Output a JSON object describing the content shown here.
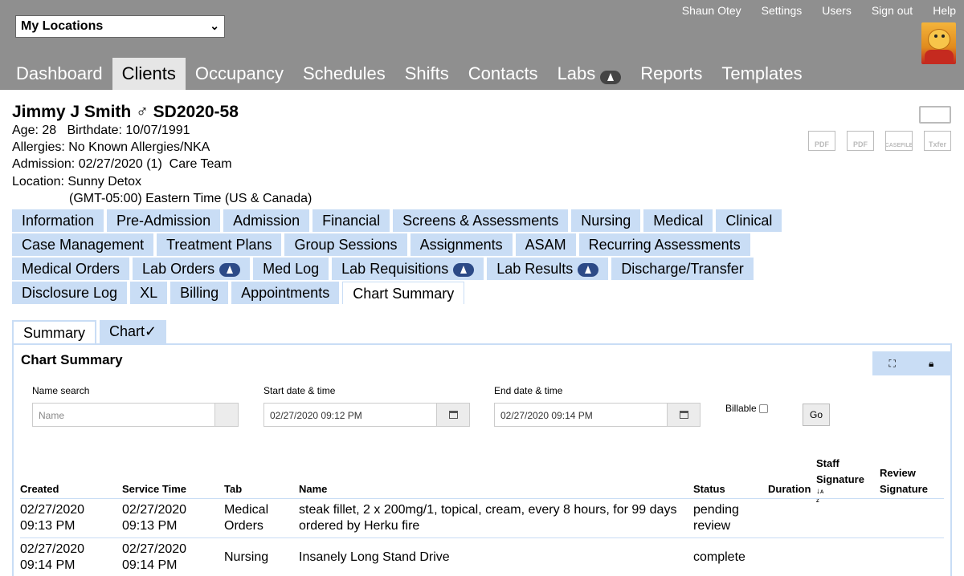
{
  "location_select": {
    "value": "My Locations"
  },
  "user_menu": [
    "Shaun Otey",
    "Settings",
    "Users",
    "Sign out",
    "Help"
  ],
  "nav": [
    {
      "label": "Dashboard",
      "active": false,
      "icon": null
    },
    {
      "label": "Clients",
      "active": true,
      "icon": null
    },
    {
      "label": "Occupancy",
      "active": false,
      "icon": null
    },
    {
      "label": "Schedules",
      "active": false,
      "icon": null
    },
    {
      "label": "Shifts",
      "active": false,
      "icon": null
    },
    {
      "label": "Contacts",
      "active": false,
      "icon": null
    },
    {
      "label": "Labs",
      "active": false,
      "icon": "flask-icon"
    },
    {
      "label": "Reports",
      "active": false,
      "icon": null
    },
    {
      "label": "Templates",
      "active": false,
      "icon": null
    }
  ],
  "patient": {
    "name": "Jimmy J Smith",
    "gender_symbol": "♂",
    "id": "SD2020-58",
    "age": "Age: 28",
    "birthdate": "Birthdate: 10/07/1991",
    "allergies": "Allergies: No Known Allergies/NKA",
    "admission": "Admission: 02/27/2020 (1)",
    "care_team": "Care Team",
    "location": "Location: Sunny Detox",
    "timezone": "(GMT-05:00) Eastern Time (US & Canada)"
  },
  "doc_icons": [
    "PDF",
    "PDF",
    "CASEFILE",
    "Txfer"
  ],
  "tab_rows": [
    [
      {
        "label": "Information"
      },
      {
        "label": "Pre-Admission"
      },
      {
        "label": "Admission"
      },
      {
        "label": "Financial"
      },
      {
        "label": "Screens & Assessments"
      },
      {
        "label": "Nursing"
      },
      {
        "label": "Medical"
      },
      {
        "label": "Clinical"
      }
    ],
    [
      {
        "label": "Case Management"
      },
      {
        "label": "Treatment Plans"
      },
      {
        "label": "Group Sessions"
      },
      {
        "label": "Assignments"
      },
      {
        "label": "ASAM"
      },
      {
        "label": "Recurring Assessments"
      }
    ],
    [
      {
        "label": "Medical Orders"
      },
      {
        "label": "Lab Orders",
        "icon": "flask-icon"
      },
      {
        "label": "Med Log"
      },
      {
        "label": "Lab Requisitions",
        "icon": "flask-icon"
      },
      {
        "label": "Lab Results",
        "icon": "flask-icon"
      },
      {
        "label": "Discharge/Transfer"
      }
    ],
    [
      {
        "label": "Disclosure Log"
      },
      {
        "label": "XL"
      },
      {
        "label": "Billing"
      },
      {
        "label": "Appointments"
      },
      {
        "label": "Chart Summary",
        "active": true
      }
    ]
  ],
  "subtabs": [
    {
      "label": "Summary",
      "active": true
    },
    {
      "label": "Chart✓",
      "active": false
    }
  ],
  "panel": {
    "title": "Chart Summary",
    "name_search": {
      "label": "Name search",
      "placeholder": "Name"
    },
    "start": {
      "label": "Start date & time",
      "value": "02/27/2020 09:12 PM"
    },
    "end": {
      "label": "End date & time",
      "value": "02/27/2020 09:14 PM"
    },
    "billable_label": "Billable",
    "go_label": "Go"
  },
  "table": {
    "headers": {
      "created": "Created",
      "service_time": "Service Time",
      "tab": "Tab",
      "name": "Name",
      "status": "Status",
      "duration": "Duration",
      "staff_signature_1": "Staff",
      "staff_signature_2": "Signature",
      "review_signature_1": "Review",
      "review_signature_2": "Signature"
    },
    "rows": [
      {
        "created_1": "02/27/2020",
        "created_2": "09:13 PM",
        "service_1": "02/27/2020",
        "service_2": "09:13 PM",
        "tab_1": "Medical",
        "tab_2": "Orders",
        "name_1": "steak fillet, 2 x 200mg/1, topical, cream, every 8 hours, for 99 days",
        "name_2": "ordered by Herku fire",
        "status_1": "pending",
        "status_2": "review"
      },
      {
        "created_1": "02/27/2020",
        "created_2": "09:14 PM",
        "service_1": "02/27/2020",
        "service_2": "09:14 PM",
        "tab_1": "Nursing",
        "tab_2": "",
        "name_1": "Insanely Long Stand Drive",
        "name_2": "",
        "status_1": "complete",
        "status_2": ""
      }
    ]
  }
}
